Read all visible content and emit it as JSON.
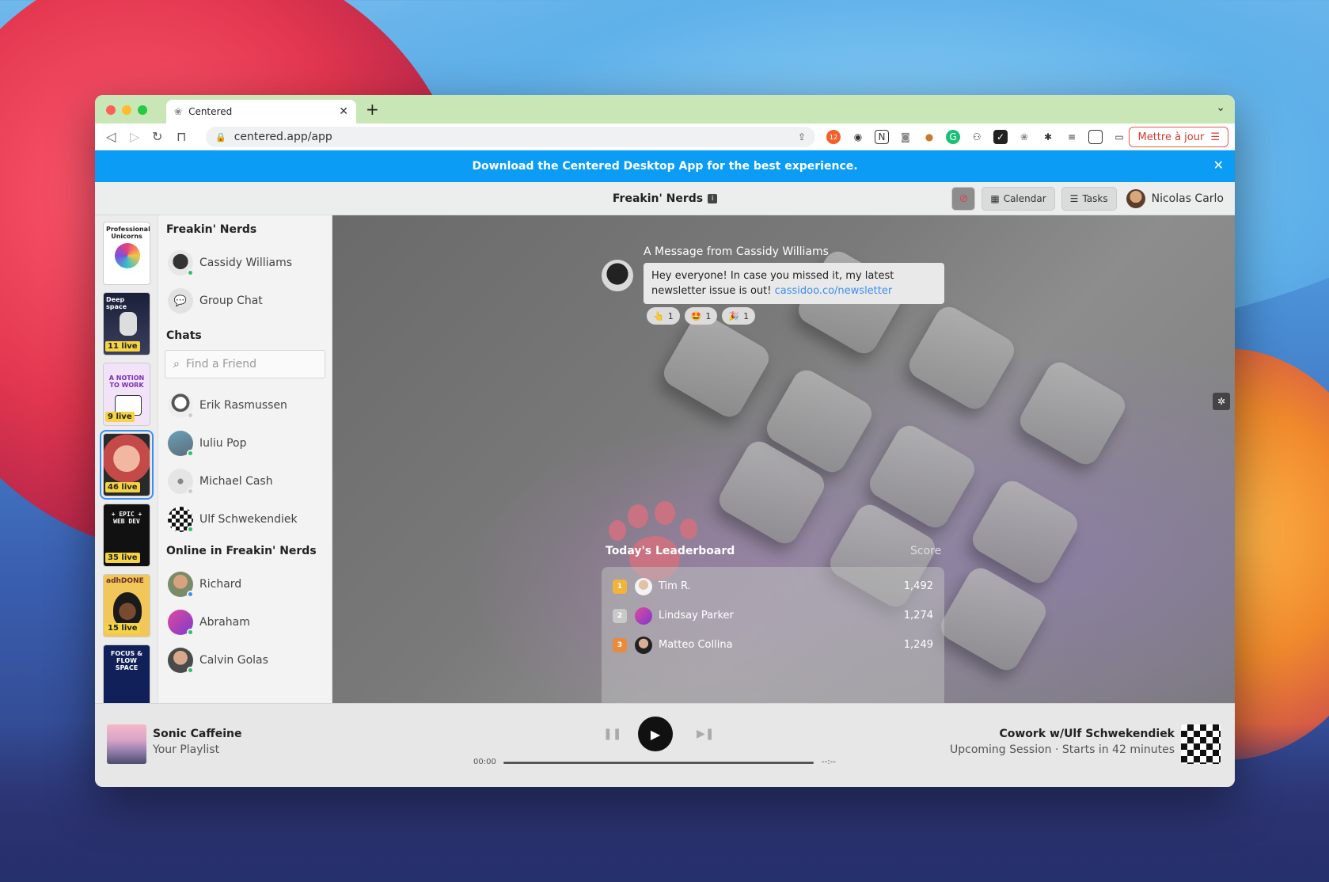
{
  "browser": {
    "tab_title": "Centered",
    "url": "centered.app/app",
    "ext_badge": "12",
    "update_label": "Mettre à jour"
  },
  "banner": {
    "text": "Download the Centered Desktop App for the best experience."
  },
  "header": {
    "title": "Freakin' Nerds",
    "calendar_label": "Calendar",
    "tasks_label": "Tasks",
    "user_name": "Nicolas Carlo"
  },
  "rooms": [
    {
      "label": "Professional Unicorns",
      "live": ""
    },
    {
      "label": "Deep space",
      "live": "11 live"
    },
    {
      "label": "A NOTION TO WORK",
      "live": "9 live"
    },
    {
      "label": "",
      "live": "46 live"
    },
    {
      "label": "+ EPIC + WEB DEV",
      "live": "35 live"
    },
    {
      "label": "adhDONE",
      "live": "15 live"
    },
    {
      "label": "FOCUS & FLOW SPACE",
      "live": ""
    }
  ],
  "sidebar": {
    "group_title": "Freakin' Nerds",
    "group_items": [
      "Cassidy Williams",
      "Group Chat"
    ],
    "chats_title": "Chats",
    "search_placeholder": "Find a Friend",
    "chats": [
      "Erik Rasmussen",
      "Iuliu Pop",
      "Michael Cash",
      "Ulf Schwekendiek"
    ],
    "online_title": "Online in Freakin' Nerds",
    "online": [
      "Richard",
      "Abraham",
      "Calvin Golas"
    ]
  },
  "message": {
    "title": "A Message from Cassidy Williams",
    "text": "Hey everyone! In case you missed it, my latest newsletter issue is out!",
    "link": "cassidoo.co/newsletter",
    "reactions": [
      {
        "emoji": "👆",
        "count": "1"
      },
      {
        "emoji": "🤩",
        "count": "1"
      },
      {
        "emoji": "🎉",
        "count": "1"
      }
    ]
  },
  "leaderboard": {
    "title": "Today's Leaderboard",
    "score_label": "Score",
    "rows": [
      {
        "rank": "1",
        "name": "Tim R.",
        "score": "1,492",
        "medal_color": "#f0b43a"
      },
      {
        "rank": "2",
        "name": "Lindsay Parker",
        "score": "1,274",
        "medal_color": "#c9c9c9"
      },
      {
        "rank": "3",
        "name": "Matteo Collina",
        "score": "1,249",
        "medal_color": "#e98b3a"
      }
    ]
  },
  "player": {
    "track": "Sonic Caffeine",
    "playlist": "Your Playlist",
    "elapsed": "00:00",
    "remaining": "--:--",
    "session_title": "Cowork w/Ulf Schwekendiek",
    "session_sub": "Upcoming Session · Starts in 42 minutes"
  },
  "colors": {
    "banner": "#0b9cf5",
    "accent": "#3a8ef6",
    "online": "#2fbf71"
  }
}
